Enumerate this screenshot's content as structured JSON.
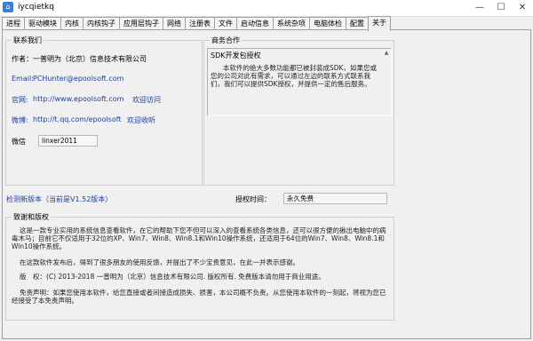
{
  "window": {
    "title": "iycqietkq",
    "minimize": "—",
    "maximize": "☐",
    "close": "✕"
  },
  "tabs": [
    "进程",
    "驱动模块",
    "内核",
    "内核钩子",
    "应用层钩子",
    "网络",
    "注册表",
    "文件",
    "启动信息",
    "系统杂项",
    "电脑体检",
    "配置",
    "关于"
  ],
  "active_tab": "关于",
  "contact": {
    "title": "联系我们",
    "author_label": "作者：",
    "author": "一普明为（北京）信息技术有限公司",
    "email_label": "Email:",
    "email": "PCHunter@epoolsoft.com",
    "website_label": "官网:",
    "website": "http://www.epoolsoft.com",
    "website_note": "欢迎访问",
    "weibo_label": "微博:",
    "weibo": "http://t.qq.com/epoolsoft",
    "weibo_note": "欢迎收听",
    "wechat_label": "微信",
    "wechat": "linxer2011"
  },
  "business": {
    "title": "商务合作",
    "heading": "SDK开发包授权",
    "text": "本软件的绝大多数功能都已被封装成SDK，如果您或您的公司对此有需求，可以通过左边的联系方式联系我们，我们可以提供SDK授权，并提供一定的售后服务。"
  },
  "update": {
    "check_link": "检测新版本（当前是V1.52版本）",
    "auth_label": "授权时间：",
    "auth_value": "永久免费"
  },
  "thanks": {
    "title": "致谢和版权",
    "p1": "这是一款专业实用的系统信息查看软件，在它的帮助下您不但可以深入的查看系统各类信息，还可以很方便的揪出电脑中的病毒木马；目前它不仅适用于32位的XP、Win7、Win8、Win8.1和Win10操作系统，还适用于64位的Win7、Win8、Win8.1和Win10操作系统。",
    "p2": "在这款软件发布后，得到了很多朋友的使用反馈，并提出了不少宝贵意见，在此一并表示感谢。",
    "p3": "版　权：(C) 2013-2018 一普明为（北京）信息技术有限公司. 版权所有. 免费版本请勿用于商业用途。",
    "p4": "免责声明：如果您使用本软件，给您直接或者间接造成损失、损害，本公司概不负责。从您使用本软件的一刻起，将视为您已经接受了本免责声明。"
  }
}
